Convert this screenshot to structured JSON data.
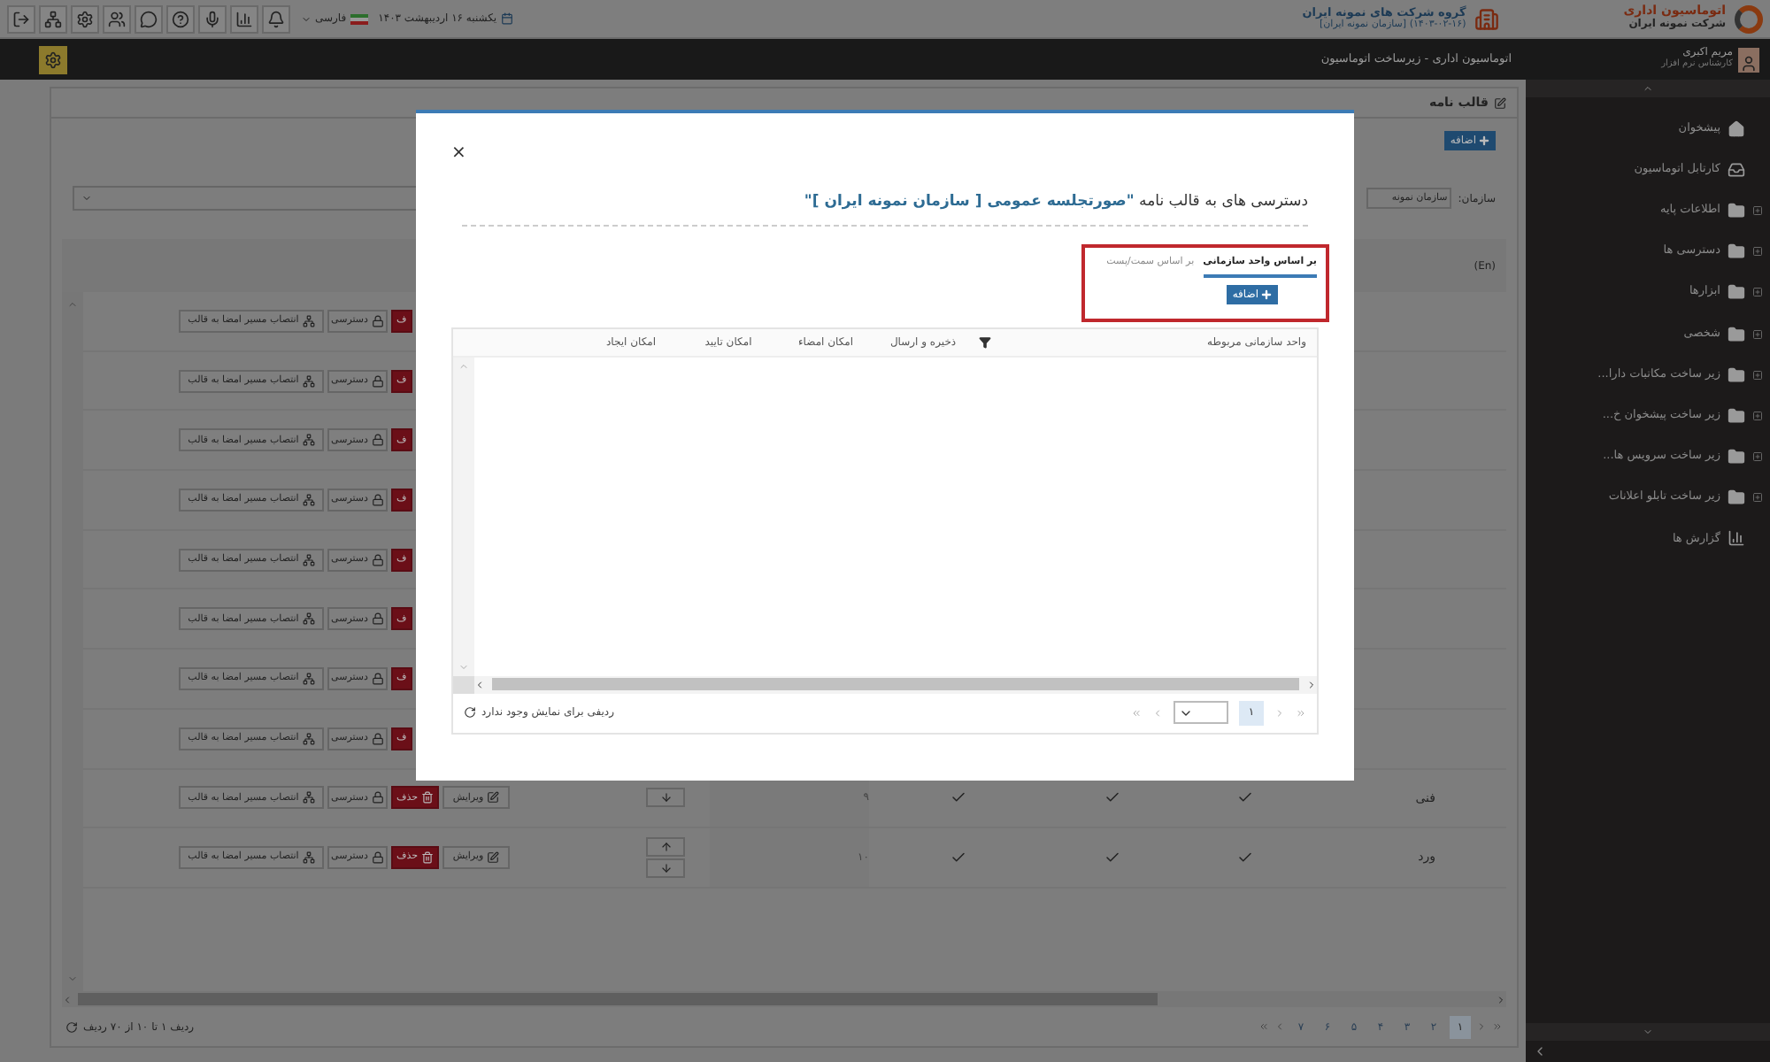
{
  "top_bar": {
    "logo_title": "اتوماسیون اداری",
    "logo_subtitle": "شرکت نمونه ایران",
    "company": "گروه شرکت های نمونه ایران",
    "company_sub": "(۱۴۰۳-۰۲-۱۶) [سازمان نمونه ایران]",
    "date": "یکشنبه ۱۶ اردیبهشت ۱۴۰۳",
    "language": "فارسی"
  },
  "user_bar": {
    "user_name": "مریم اکبری",
    "user_role": "کارشناس نرم افزار",
    "breadcrumb": "اتوماسیون اداری - زیرساخت اتوماسیون"
  },
  "sidebar": {
    "items": [
      {
        "label": "پیشخوان",
        "kind": "home"
      },
      {
        "label": "کارتابل اتوماسیون",
        "kind": "inbox"
      },
      {
        "label": "اطلاعات پایه",
        "kind": "folder"
      },
      {
        "label": "دسترسی ها",
        "kind": "folder"
      },
      {
        "label": "ابزارها",
        "kind": "folder"
      },
      {
        "label": "شخصی",
        "kind": "folder"
      },
      {
        "label": "زیر ساخت مکاتبات دارا...",
        "kind": "folder"
      },
      {
        "label": "زیر ساخت پیشخوان خ...",
        "kind": "folder"
      },
      {
        "label": "زیر ساخت سرویس ها...",
        "kind": "folder"
      },
      {
        "label": "زیر ساخت تابلو اعلانات",
        "kind": "folder"
      },
      {
        "label": "گزارش ها",
        "kind": "chart"
      }
    ]
  },
  "panel": {
    "title": "قالب نامه",
    "add_button": "اضافه",
    "org_label": "سازمان:",
    "org_value": "سازمان نمونه",
    "header_cell": "(En)"
  },
  "rows": [
    {
      "actions": [
        {
          "kind": "delete",
          "label": "ف"
        },
        {
          "kind": "access",
          "label": "دسترسی"
        },
        {
          "kind": "assign",
          "label": "انتصاب مسیر امضا به قالب"
        }
      ]
    },
    {
      "actions": [
        {
          "kind": "delete",
          "label": "ف"
        },
        {
          "kind": "access",
          "label": "دسترسی"
        },
        {
          "kind": "assign",
          "label": "انتصاب مسیر امضا به قالب"
        }
      ]
    },
    {
      "actions": [
        {
          "kind": "delete",
          "label": "ف"
        },
        {
          "kind": "access",
          "label": "دسترسی"
        },
        {
          "kind": "assign",
          "label": "انتصاب مسیر امضا به قالب"
        }
      ]
    },
    {
      "actions": [
        {
          "kind": "delete",
          "label": "ف"
        },
        {
          "kind": "access",
          "label": "دسترسی"
        },
        {
          "kind": "assign",
          "label": "انتصاب مسیر امضا به قالب"
        }
      ]
    },
    {
      "actions": [
        {
          "kind": "delete",
          "label": "ف"
        },
        {
          "kind": "access",
          "label": "دسترسی"
        },
        {
          "kind": "assign",
          "label": "انتصاب مسیر امضا به قالب"
        }
      ]
    },
    {
      "actions": [
        {
          "kind": "delete",
          "label": "ف"
        },
        {
          "kind": "access",
          "label": "دسترسی"
        },
        {
          "kind": "assign",
          "label": "انتصاب مسیر امضا به قالب"
        }
      ]
    },
    {
      "actions": [
        {
          "kind": "delete",
          "label": "ف"
        },
        {
          "kind": "access",
          "label": "دسترسی"
        },
        {
          "kind": "assign",
          "label": "انتصاب مسیر امضا به قالب"
        }
      ]
    },
    {
      "actions": [
        {
          "kind": "delete",
          "label": "ف"
        },
        {
          "kind": "access",
          "label": "دسترسی"
        },
        {
          "kind": "assign",
          "label": "انتصاب مسیر امضا به قالب"
        }
      ]
    },
    {
      "actions": [
        {
          "kind": "edit",
          "label": "ویرایش"
        },
        {
          "kind": "delete",
          "label": "حذف"
        },
        {
          "kind": "access",
          "label": "دسترسی"
        },
        {
          "kind": "assign",
          "label": "انتصاب مسیر امضا به قالب"
        }
      ],
      "order": [
        {
          "kind": "down"
        }
      ],
      "number": "۹",
      "checks": [
        true,
        true,
        true
      ],
      "name": "فنی"
    },
    {
      "actions": [
        {
          "kind": "edit",
          "label": "ویرایش"
        },
        {
          "kind": "delete",
          "label": "حذف"
        },
        {
          "kind": "access",
          "label": "دسترسی"
        },
        {
          "kind": "assign",
          "label": "انتصاب مسیر امضا به قالب"
        }
      ],
      "order": [
        {
          "kind": "up"
        },
        {
          "kind": "down"
        }
      ],
      "number": "۱۰",
      "checks": [
        true,
        true,
        true
      ],
      "name": "ورد"
    }
  ],
  "pager": {
    "pages": [
      {
        "label": "۱",
        "selected": true
      },
      {
        "label": "۲",
        "selected": false
      },
      {
        "label": "۳",
        "selected": false
      },
      {
        "label": "۴",
        "selected": false
      },
      {
        "label": "۵",
        "selected": false
      },
      {
        "label": "۶",
        "selected": false
      },
      {
        "label": "۷",
        "selected": false
      }
    ],
    "summary": "ردیف ۱ تا ۱۰ از ۷۰ ردیف"
  },
  "modal": {
    "close": "×",
    "title": "دسترسی های به قالب نامه ",
    "title_link": "\"صورتجلسه عمومی [ سازمان نمونه ایران ]\"",
    "tabs": [
      {
        "label": "بر اساس واحد سازمانی",
        "selected": true
      },
      {
        "label": "بر اساس سمت/پست",
        "selected": false
      }
    ],
    "add_button": "اضافه",
    "columns": [
      "واحد سازمانی مربوطه",
      "ذخیره و ارسال",
      "امکان امضاء",
      "امکان تایید",
      "امکان ایجاد"
    ],
    "empty_message": "ردیفی برای نمایش وجود ندارد",
    "pages": [
      {
        "label": "۱",
        "selected": true
      }
    ]
  }
}
